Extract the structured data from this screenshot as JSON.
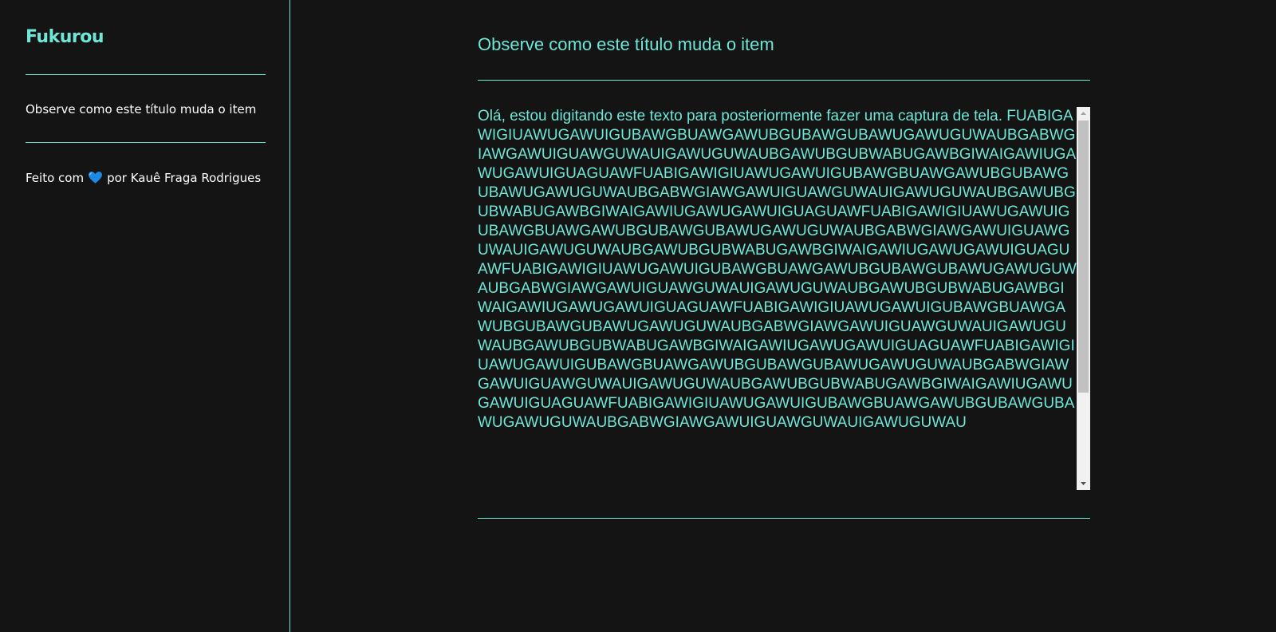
{
  "sidebar": {
    "brand": "Fukurou",
    "notes": [
      {
        "label": "Observe como este título muda o item"
      }
    ],
    "footer": {
      "prefix": "Feito com",
      "suffix": "por Kauê Fraga Rodrigues",
      "heart_icon": "blue-heart-icon"
    }
  },
  "editor": {
    "title_value": "Observe como este título muda o item",
    "body_text": "Olá, estou digitando este texto para posteriormente fazer uma captura de tela. FUABIGAWIGIUAWUGAWUIGUBAWGBUAWGAWUBGUBAWGUBAWUGAWUGUWAUBGABWGIAWGAWUIGUAWGUWAUIGAWUGUWAUBGAWUBGUBWABUGAWBGIWAIGAWIUGAWUGAWUIGUAGUAWFUABIGAWIGIUAWUGAWUIGUBAWGBUAWGAWUBGUBAWGUBAWUGAWUGUWAUBGABWGIAWGAWUIGUAWGUWAUIGAWUGUWAUBGAWUBGUBWABUGAWBGIWAIGAWIUGAWUGAWUIGUAGUAWFUABIGAWIGIUAWUGAWUIGUBAWGBUAWGAWUBGUBAWGUBAWUGAWUGUWAUBGABWGIAWGAWUIGUAWGUWAUIGAWUGUWAUBGAWUBGUBWABUGAWBGIWAIGAWIUGAWUGAWUIGUAGUAWFUABIGAWIGIUAWUGAWUIGUBAWGBUAWGAWUBGUBAWGUBAWUGAWUGUWAUBGABWGIAWGAWUIGUAWGUWAUIGAWUGUWAUBGAWUBGUBWABUGAWBGIWAIGAWIUGAWUGAWUIGUAGUAWFUABIGAWIGIUAWUGAWUIGUBAWGBUAWGAWUBGUBAWGUBAWUGAWUGUWAUBGABWGIAWGAWUIGUAWGUWAUIGAWUGUWAUBGAWUBGUBWABUGAWBGIWAIGAWIUGAWUGAWUIGUAGUAWFUABIGAWIGIUAWUGAWUIGUBAWGBUAWGAWUBGUBAWGUBAWUGAWUGUWAUBGABWGIAWGAWUIGUAWGUWAUIGAWUGUWAUBGAWUBGUBWABUGAWBGIWAIGAWIUGAWUGAWUIGUAGUAWFUABIGAWIGIUAWUGAWUIGUBAWGBUAWGAWUBGUBAWGUBAWUGAWUGUWAUBGABWGIAWGAWUIGUAWGUWAUIGAWUGUWAU"
  },
  "colors": {
    "accent": "#6ee7d8",
    "background": "#141414",
    "text": "#ffffff"
  }
}
